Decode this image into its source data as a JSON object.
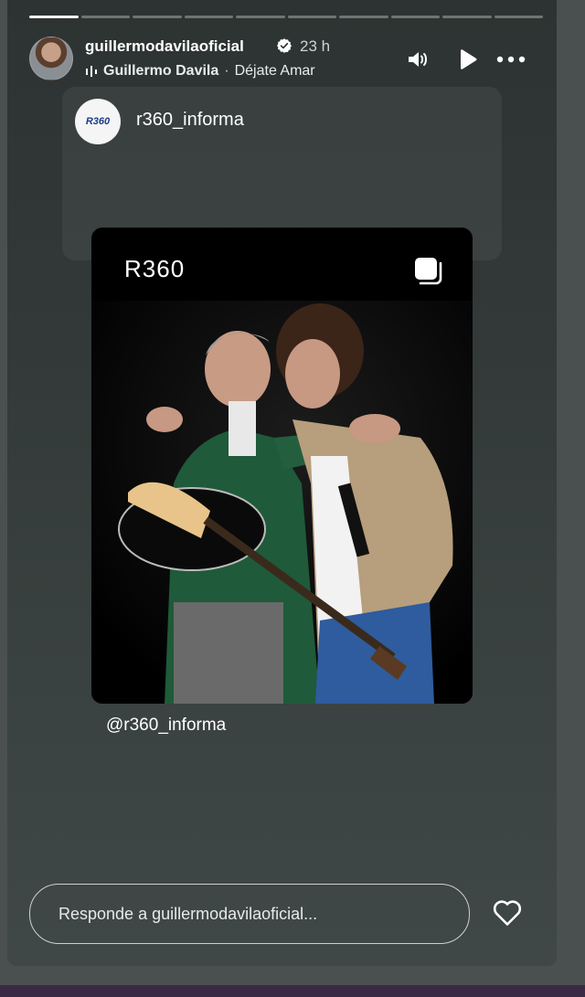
{
  "progress": {
    "segments": 10,
    "active_index": 0
  },
  "header": {
    "username": "guillermodavilaoficial",
    "time": "23 h",
    "music_artist": "Guillermo Davila",
    "music_separator": "·",
    "music_song": "Déjate Amar"
  },
  "shared_card": {
    "avatar_text": "R360",
    "account_name": "r360_informa"
  },
  "post": {
    "logo_text": "R360",
    "mention": "@r360_informa"
  },
  "reply": {
    "placeholder": "Responde a guillermodavilaoficial..."
  },
  "icons": {
    "verified": "verified-badge-icon",
    "music": "music-bars-icon",
    "sound": "speaker-icon",
    "play": "play-icon",
    "more": "more-dots-icon",
    "multi": "carousel-icon",
    "heart": "heart-icon"
  },
  "colors": {
    "background": "#4a4f4f",
    "story_top": "#2d3332",
    "story_bottom": "#3f4847",
    "verified": "#ffffff"
  }
}
